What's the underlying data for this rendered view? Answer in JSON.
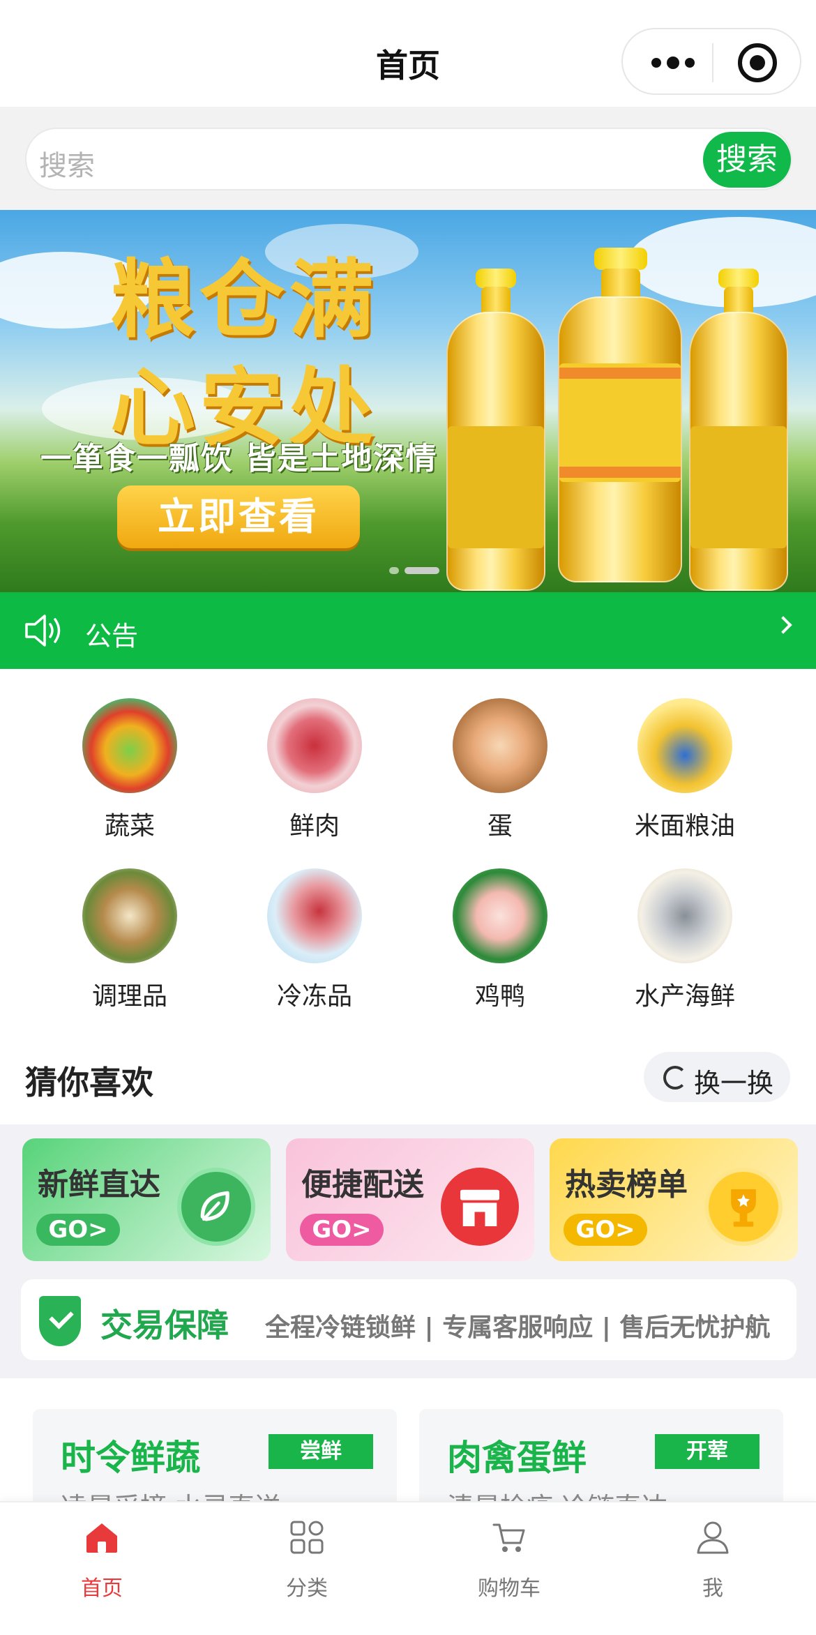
{
  "header": {
    "title": "首页"
  },
  "search": {
    "placeholder": "搜索",
    "button": "搜索"
  },
  "banner": {
    "line1": "粮仓满",
    "line2": "心安处",
    "subtitle": "一箪食一瓢饮 皆是土地深情",
    "button": "立即查看"
  },
  "notice": {
    "label": "公告"
  },
  "categories": [
    {
      "name": "蔬菜"
    },
    {
      "name": "鲜肉"
    },
    {
      "name": "蛋"
    },
    {
      "name": "米面粮油"
    },
    {
      "name": "调理品"
    },
    {
      "name": "冷冻品"
    },
    {
      "name": "鸡鸭"
    },
    {
      "name": "水产海鲜"
    }
  ],
  "guess": {
    "title": "猜你喜欢",
    "swap_label": "换一换"
  },
  "promos": [
    {
      "title": "新鲜直达",
      "go": "GO>"
    },
    {
      "title": "便捷配送",
      "go": "GO>"
    },
    {
      "title": "热卖榜单",
      "go": "GO>"
    }
  ],
  "guarantee": {
    "title": "交易保障",
    "text": "全程冷链锁鲜 | 专属客服响应 | 售后无忧护航"
  },
  "cards": [
    {
      "title": "时令鲜蔬",
      "tag": "尝鲜",
      "subtitle": "凌晨采摘 水灵直送"
    },
    {
      "title": "肉禽蛋鲜",
      "tag": "开荤",
      "subtitle": "清晨检疫 冷链直达"
    }
  ],
  "tabbar": [
    {
      "label": "首页",
      "icon": "home-icon",
      "active": true
    },
    {
      "label": "分类",
      "icon": "category-icon",
      "active": false
    },
    {
      "label": "购物车",
      "icon": "cart-icon",
      "active": false
    },
    {
      "label": "我",
      "icon": "user-icon",
      "active": false
    }
  ],
  "colors": {
    "brand_green": "#0dbb44",
    "active_red": "#e83a3a"
  }
}
